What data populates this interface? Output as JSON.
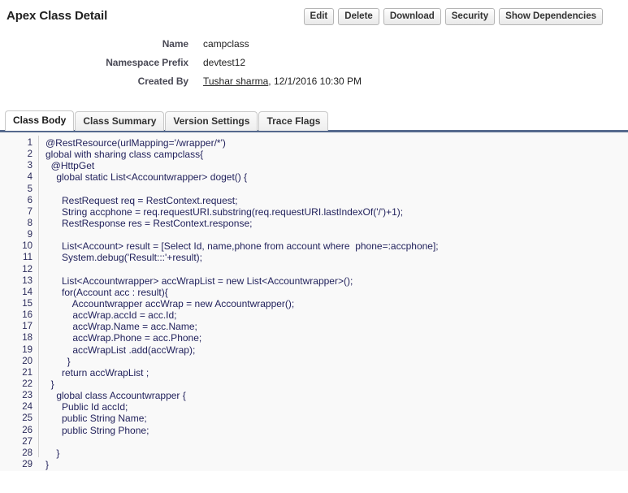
{
  "header": {
    "title": "Apex Class Detail",
    "buttons": [
      {
        "label": "Edit",
        "name": "edit-button"
      },
      {
        "label": "Delete",
        "name": "delete-button"
      },
      {
        "label": "Download",
        "name": "download-button"
      },
      {
        "label": "Security",
        "name": "security-button"
      },
      {
        "label": "Show Dependencies",
        "name": "show-dependencies-button"
      }
    ]
  },
  "detail": {
    "rows": [
      {
        "label": "Name",
        "value": "campclass"
      },
      {
        "label": "Namespace Prefix",
        "value": "devtest12"
      }
    ],
    "created_by": {
      "label": "Created By",
      "user": "Tushar sharma",
      "comma": ",",
      "date": "12/1/2016 10:30 PM"
    }
  },
  "tabs": [
    {
      "label": "Class Body",
      "active": true
    },
    {
      "label": "Class Summary",
      "active": false
    },
    {
      "label": "Version Settings",
      "active": false
    },
    {
      "label": "Trace Flags",
      "active": false
    }
  ],
  "code": {
    "language": "apex",
    "line_count": 29,
    "lines": [
      {
        "n": "1",
        "text": "@RestResource(urlMapping='/wrapper/*')"
      },
      {
        "n": "2",
        "text": "global with sharing class campclass{"
      },
      {
        "n": "3",
        "text": "  @HttpGet"
      },
      {
        "n": "4",
        "text": "    global static List<Accountwrapper> doget() {"
      },
      {
        "n": "5",
        "text": ""
      },
      {
        "n": "6",
        "text": "      RestRequest req = RestContext.request;"
      },
      {
        "n": "7",
        "text": "      String accphone = req.requestURI.substring(req.requestURI.lastIndexOf('/')+1);"
      },
      {
        "n": "8",
        "text": "      RestResponse res = RestContext.response;"
      },
      {
        "n": "9",
        "text": ""
      },
      {
        "n": "10",
        "text": "      List<Account> result = [Select Id, name,phone from account where  phone=:accphone];"
      },
      {
        "n": "11",
        "text": "      System.debug('Result:::'+result);"
      },
      {
        "n": "12",
        "text": ""
      },
      {
        "n": "13",
        "text": "      List<Accountwrapper> accWrapList = new List<Accountwrapper>();"
      },
      {
        "n": "14",
        "text": "      for(Account acc : result){"
      },
      {
        "n": "15",
        "text": "          Accountwrapper accWrap = new Accountwrapper();"
      },
      {
        "n": "16",
        "text": "          accWrap.accId = acc.Id;"
      },
      {
        "n": "17",
        "text": "          accWrap.Name = acc.Name;"
      },
      {
        "n": "18",
        "text": "          accWrap.Phone = acc.Phone;"
      },
      {
        "n": "19",
        "text": "          accWrapList .add(accWrap);"
      },
      {
        "n": "20",
        "text": "        }"
      },
      {
        "n": "21",
        "text": "      return accWrapList ;"
      },
      {
        "n": "22",
        "text": "  }"
      },
      {
        "n": "23",
        "text": "    global class Accountwrapper {"
      },
      {
        "n": "24",
        "text": "      Public Id accId;"
      },
      {
        "n": "25",
        "text": "      public String Name;"
      },
      {
        "n": "26",
        "text": "      public String Phone;"
      },
      {
        "n": "27",
        "text": ""
      },
      {
        "n": "28",
        "text": "    }"
      },
      {
        "n": "29",
        "text": "}"
      }
    ]
  },
  "colors": {
    "tab_underline": "#55698d",
    "code_text": "#22225c",
    "code_background": "#f9f9f9",
    "label_text": "#4a4a56"
  }
}
